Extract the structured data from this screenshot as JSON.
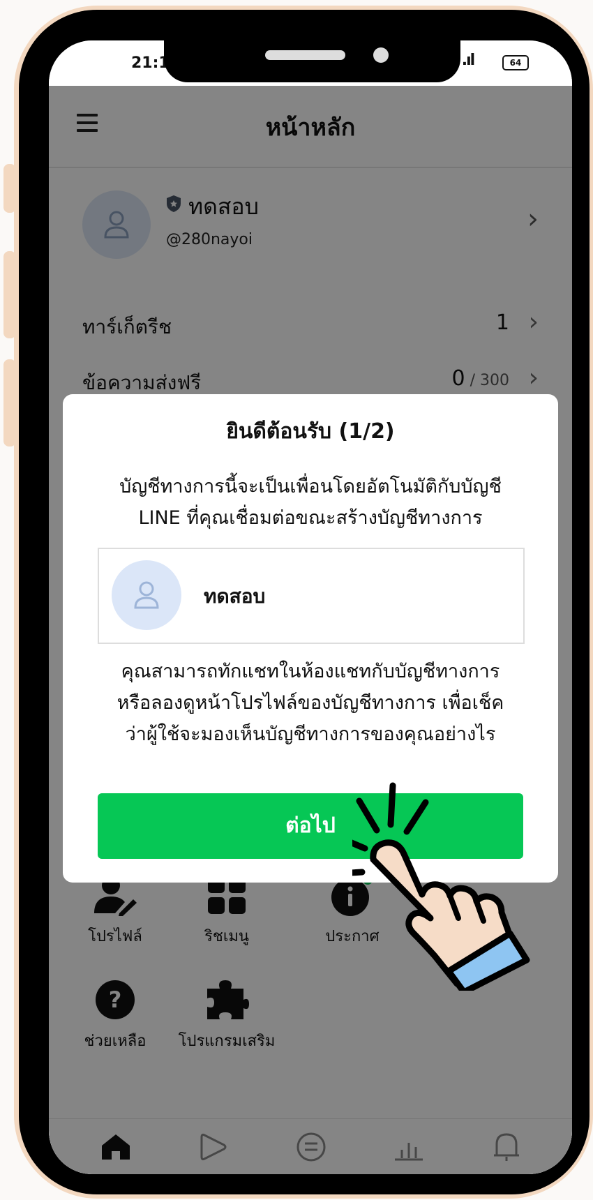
{
  "status_bar": {
    "time": "21:1",
    "signal": "ıl .ıl",
    "battery": "64"
  },
  "header": {
    "title": "หน้าหลัก"
  },
  "profile": {
    "name": "ทดสอบ",
    "handle": "@280nayoi"
  },
  "rows": [
    {
      "label": "ทาร์เก็ตรีช",
      "value": "1",
      "sub": ""
    },
    {
      "label": "ข้อความส่งฟรี",
      "value": "0",
      "sub": " / 300"
    }
  ],
  "grid": {
    "profile_label": "โปรไฟล์",
    "richmenu_label": "ริชเมนู",
    "announce_label": "ประกาศ",
    "help_label": "ช่วยเหลือ",
    "addon_label": "โปรแกรมเสริม"
  },
  "dialog": {
    "title": "ยินดีต้อนรับ (1/2)",
    "intro_line1": "บัญชีทางการนี้จะเป็นเพื่อนโดยอัตโนมัติกับบัญชี",
    "intro_line2": "LINE ที่คุณเชื่อมต่อขณะสร้างบัญชีทางการ",
    "card_name": "ทดสอบ",
    "body_line1": "คุณสามารถทักแชทในห้องแชทกับบัญชีทางการ",
    "body_line2": "หรือลองดูหน้าโปรไฟล์ของบัญชีทางการ เพื่อเช็ค",
    "body_line3": "ว่าผู้ใช้จะมองเห็นบัญชีทางการของคุณอย่างไร",
    "next_label": "ต่อไป"
  },
  "colors": {
    "accent": "#06C755",
    "frame": "#F3D8C0",
    "badge_dot": "#06C755"
  }
}
